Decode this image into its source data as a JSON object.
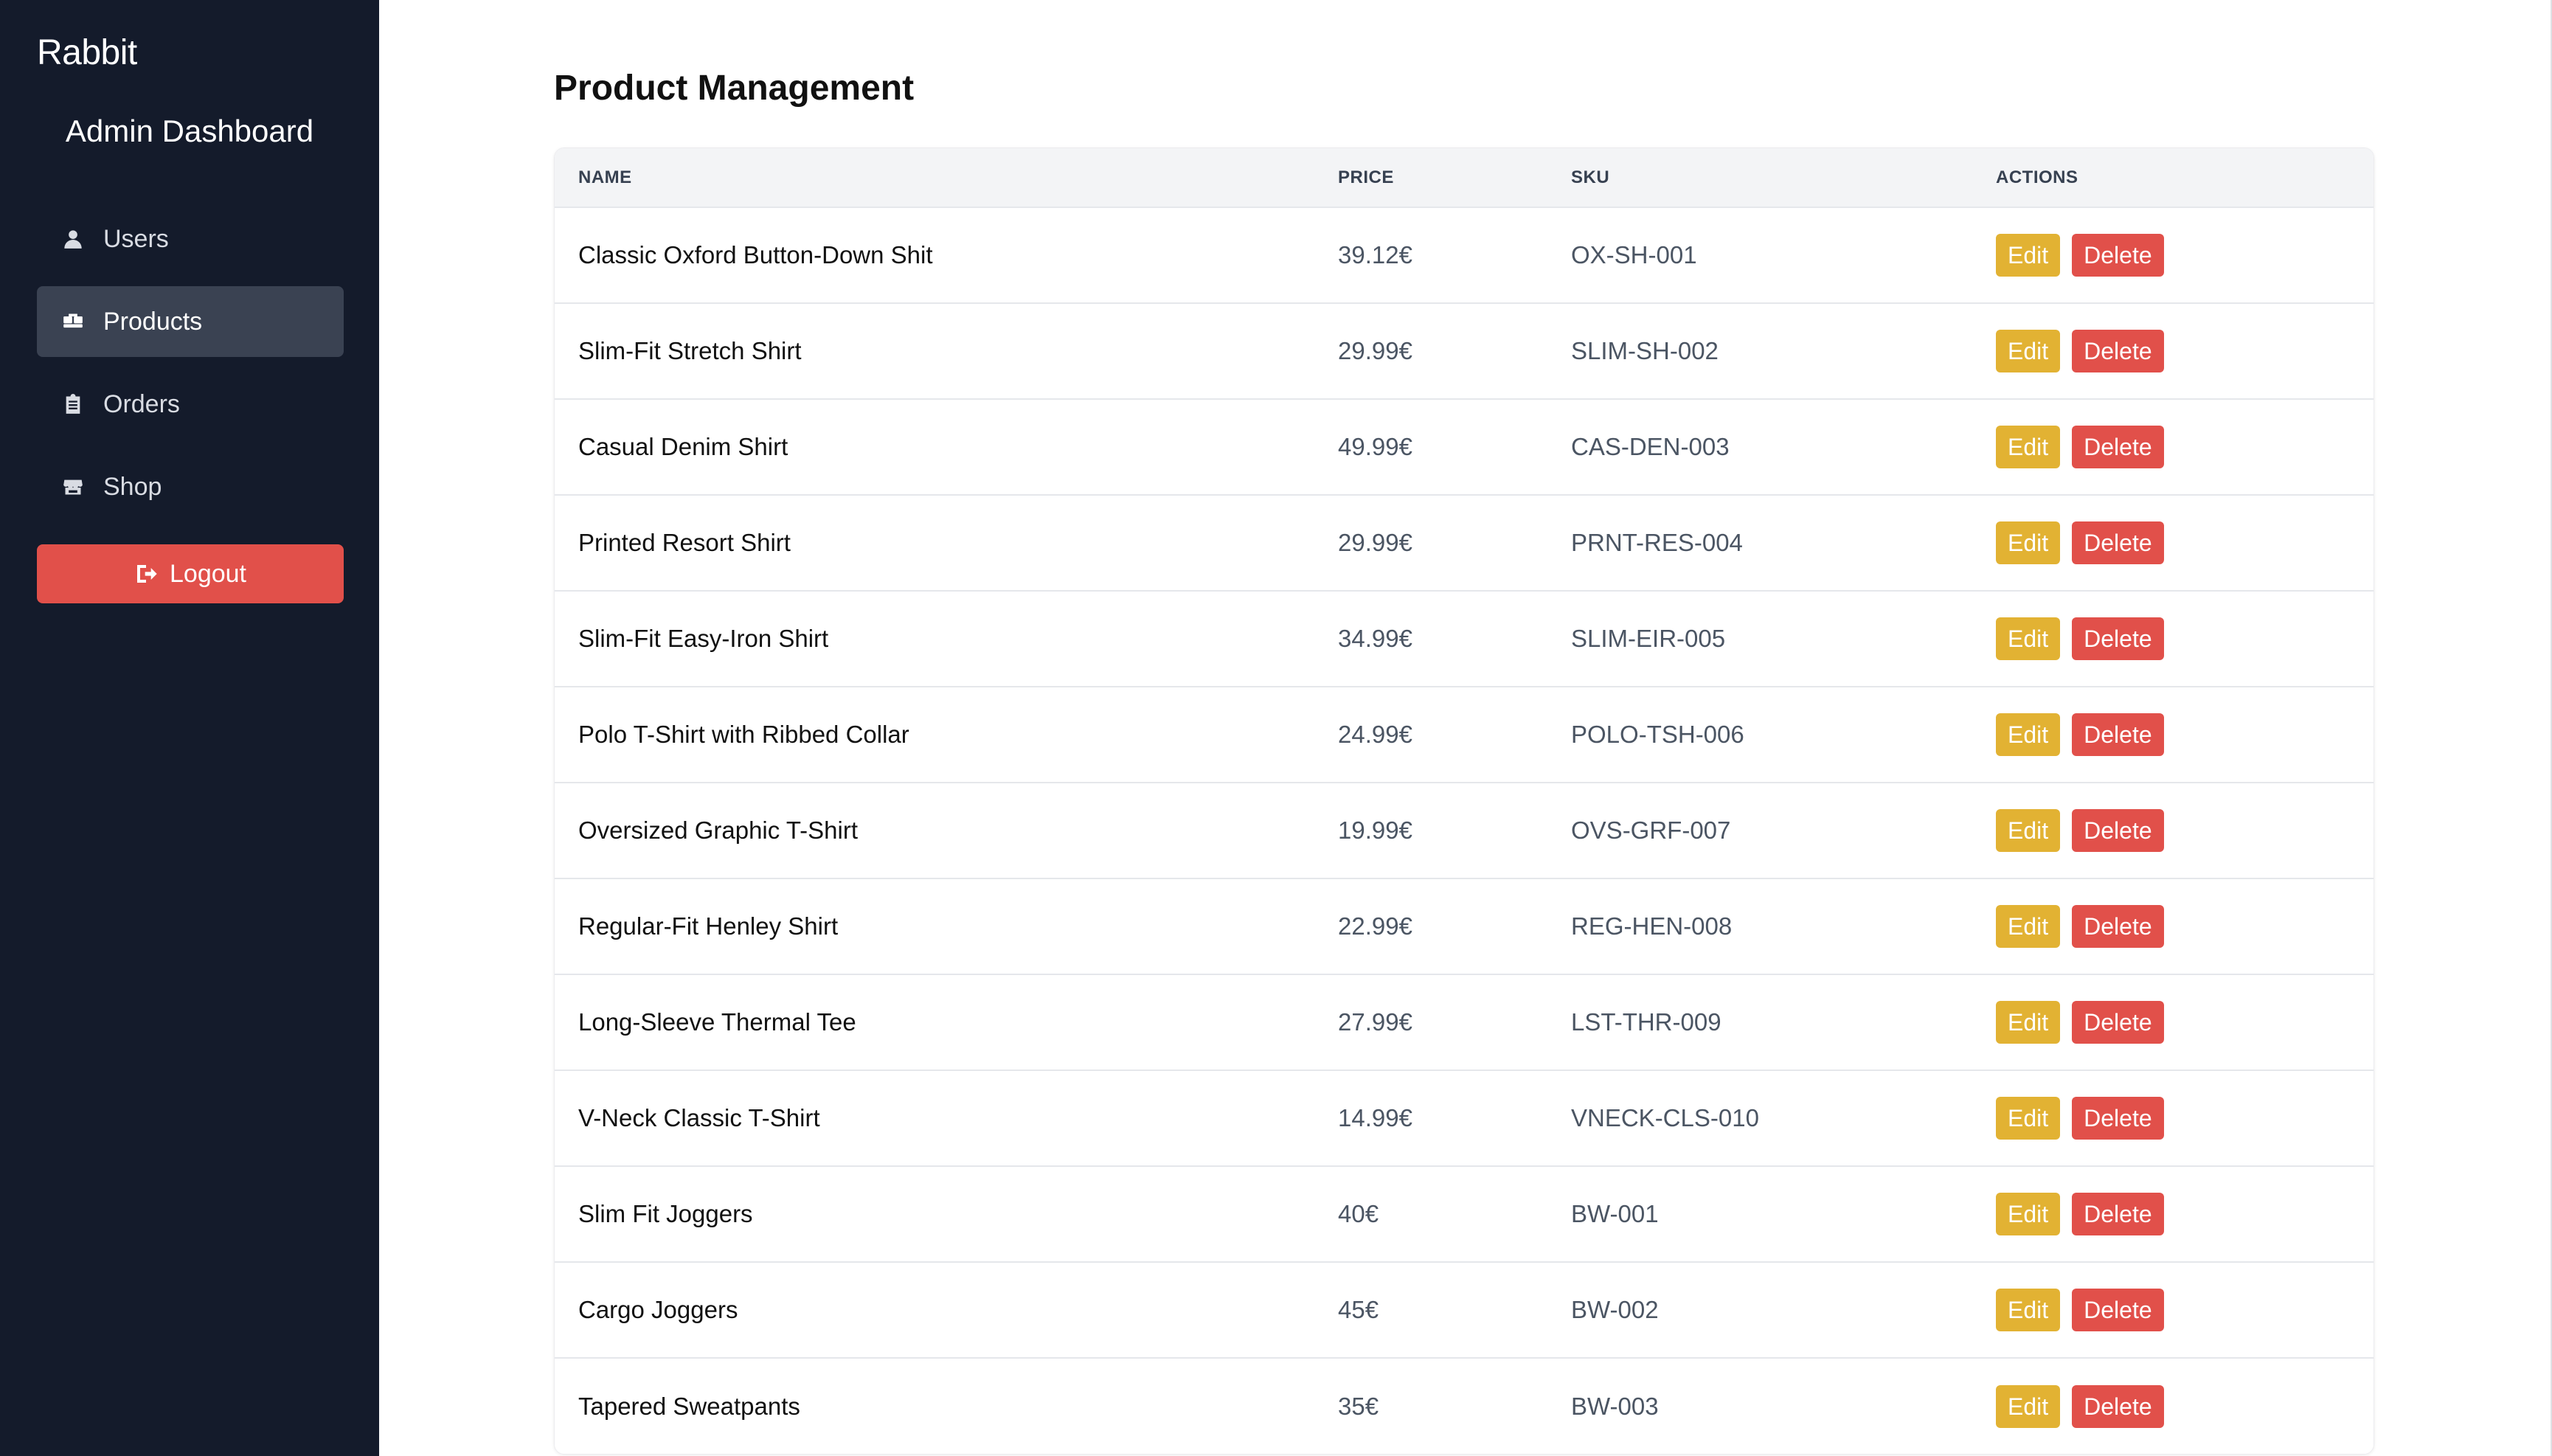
{
  "sidebar": {
    "brand": "Rabbit",
    "title": "Admin Dashboard",
    "items": [
      {
        "label": "Users",
        "icon": "user-icon",
        "active": false
      },
      {
        "label": "Products",
        "icon": "boxes-icon",
        "active": true
      },
      {
        "label": "Orders",
        "icon": "clipboard-icon",
        "active": false
      },
      {
        "label": "Shop",
        "icon": "store-icon",
        "active": false
      }
    ],
    "logout_label": "Logout"
  },
  "main": {
    "title": "Product Management",
    "columns": [
      "NAME",
      "PRICE",
      "SKU",
      "ACTIONS"
    ],
    "edit_label": "Edit",
    "delete_label": "Delete",
    "rows": [
      {
        "name": "Classic Oxford Button-Down Shit",
        "price": "39.12€",
        "sku": "OX-SH-001"
      },
      {
        "name": "Slim-Fit Stretch Shirt",
        "price": "29.99€",
        "sku": "SLIM-SH-002"
      },
      {
        "name": "Casual Denim Shirt",
        "price": "49.99€",
        "sku": "CAS-DEN-003"
      },
      {
        "name": "Printed Resort Shirt",
        "price": "29.99€",
        "sku": "PRNT-RES-004"
      },
      {
        "name": "Slim-Fit Easy-Iron Shirt",
        "price": "34.99€",
        "sku": "SLIM-EIR-005"
      },
      {
        "name": "Polo T-Shirt with Ribbed Collar",
        "price": "24.99€",
        "sku": "POLO-TSH-006"
      },
      {
        "name": "Oversized Graphic T-Shirt",
        "price": "19.99€",
        "sku": "OVS-GRF-007"
      },
      {
        "name": "Regular-Fit Henley Shirt",
        "price": "22.99€",
        "sku": "REG-HEN-008"
      },
      {
        "name": "Long-Sleeve Thermal Tee",
        "price": "27.99€",
        "sku": "LST-THR-009"
      },
      {
        "name": "V-Neck Classic T-Shirt",
        "price": "14.99€",
        "sku": "VNECK-CLS-010"
      },
      {
        "name": "Slim Fit Joggers",
        "price": "40€",
        "sku": "BW-001"
      },
      {
        "name": "Cargo Joggers",
        "price": "45€",
        "sku": "BW-002"
      },
      {
        "name": "Tapered Sweatpants",
        "price": "35€",
        "sku": "BW-003"
      }
    ]
  },
  "colors": {
    "sidebar_bg": "#141b2b",
    "active_item_bg": "#3a4252",
    "danger": "#e1504a",
    "edit": "#e2b233"
  }
}
